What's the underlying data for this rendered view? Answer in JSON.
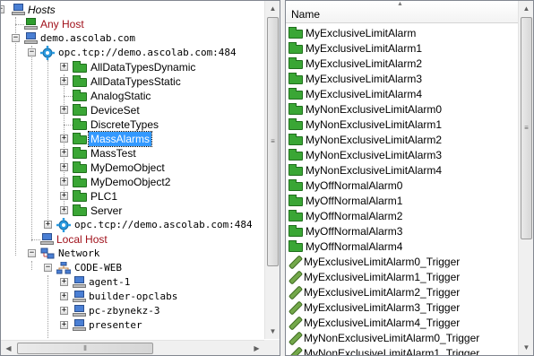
{
  "tree": {
    "nodes": [
      {
        "label": "Hosts",
        "style": "italic",
        "icon": "hosts-icon",
        "expander": "-"
      },
      {
        "label": "Any Host",
        "style": "red",
        "icon": "computer-add-icon"
      },
      {
        "label": "demo.ascolab.com",
        "style": "mono",
        "icon": "computer-icon",
        "expander": "-"
      },
      {
        "label": "opc.tcp://demo.ascolab.com:484",
        "style": "mono",
        "icon": "gear-icon",
        "expander": "-"
      },
      {
        "label": "AllDataTypesDynamic",
        "icon": "folder-icon",
        "expander": "+"
      },
      {
        "label": "AllDataTypesStatic",
        "icon": "folder-icon",
        "expander": "+"
      },
      {
        "label": "AnalogStatic",
        "icon": "folder-icon"
      },
      {
        "label": "DeviceSet",
        "icon": "folder-icon",
        "expander": "+"
      },
      {
        "label": "DiscreteTypes",
        "icon": "folder-icon"
      },
      {
        "label": "MassAlarms",
        "icon": "folder-icon",
        "expander": "+",
        "selected": true
      },
      {
        "label": "MassTest",
        "icon": "folder-icon",
        "expander": "+"
      },
      {
        "label": "MyDemoObject",
        "icon": "folder-icon",
        "expander": "+"
      },
      {
        "label": "MyDemoObject2",
        "icon": "folder-icon",
        "expander": "+"
      },
      {
        "label": "PLC1",
        "icon": "folder-icon",
        "expander": "+"
      },
      {
        "label": "Server",
        "icon": "folder-icon",
        "expander": "+"
      },
      {
        "label": "opc.tcp://demo.ascolab.com:484",
        "style": "mono",
        "icon": "gear-icon",
        "expander": "+"
      },
      {
        "label": "Local Host",
        "style": "red",
        "icon": "computer-icon"
      },
      {
        "label": "Network",
        "style": "mono",
        "icon": "network-icon",
        "expander": "-"
      },
      {
        "label": "CODE-WEB",
        "style": "mono",
        "icon": "network-icon",
        "expander": "-"
      },
      {
        "label": "agent-1",
        "style": "mono",
        "icon": "computer-icon",
        "expander": "+"
      },
      {
        "label": "builder-opclabs",
        "style": "mono",
        "icon": "computer-icon",
        "expander": "+"
      },
      {
        "label": "pc-zbynekz-3",
        "style": "mono",
        "icon": "computer-icon",
        "expander": "+"
      },
      {
        "label": "presenter",
        "style": "mono",
        "icon": "computer-icon",
        "expander": "+"
      }
    ]
  },
  "list": {
    "column_header": "Name",
    "items": [
      {
        "label": "MyExclusiveLimitAlarm",
        "icon": "folder-icon"
      },
      {
        "label": "MyExclusiveLimitAlarm1",
        "icon": "folder-icon"
      },
      {
        "label": "MyExclusiveLimitAlarm2",
        "icon": "folder-icon"
      },
      {
        "label": "MyExclusiveLimitAlarm3",
        "icon": "folder-icon"
      },
      {
        "label": "MyExclusiveLimitAlarm4",
        "icon": "folder-icon"
      },
      {
        "label": "MyNonExclusiveLimitAlarm0",
        "icon": "folder-icon"
      },
      {
        "label": "MyNonExclusiveLimitAlarm1",
        "icon": "folder-icon"
      },
      {
        "label": "MyNonExclusiveLimitAlarm2",
        "icon": "folder-icon"
      },
      {
        "label": "MyNonExclusiveLimitAlarm3",
        "icon": "folder-icon"
      },
      {
        "label": "MyNonExclusiveLimitAlarm4",
        "icon": "folder-icon"
      },
      {
        "label": "MyOffNormalAlarm0",
        "icon": "folder-icon"
      },
      {
        "label": "MyOffNormalAlarm1",
        "icon": "folder-icon"
      },
      {
        "label": "MyOffNormalAlarm2",
        "icon": "folder-icon"
      },
      {
        "label": "MyOffNormalAlarm3",
        "icon": "folder-icon"
      },
      {
        "label": "MyOffNormalAlarm4",
        "icon": "folder-icon"
      },
      {
        "label": "MyExclusiveLimitAlarm0_Trigger",
        "icon": "trigger-icon"
      },
      {
        "label": "MyExclusiveLimitAlarm1_Trigger",
        "icon": "trigger-icon"
      },
      {
        "label": "MyExclusiveLimitAlarm2_Trigger",
        "icon": "trigger-icon"
      },
      {
        "label": "MyExclusiveLimitAlarm3_Trigger",
        "icon": "trigger-icon"
      },
      {
        "label": "MyExclusiveLimitAlarm4_Trigger",
        "icon": "trigger-icon"
      },
      {
        "label": "MyNonExclusiveLimitAlarm0_Trigger",
        "icon": "trigger-icon"
      },
      {
        "label": "MyNonExclusiveLimitAlarm1_Trigger",
        "icon": "trigger-icon"
      }
    ]
  },
  "colors": {
    "selection": "#3399ff",
    "red_text": "#a0101a",
    "folder_green": "#3aa635"
  }
}
